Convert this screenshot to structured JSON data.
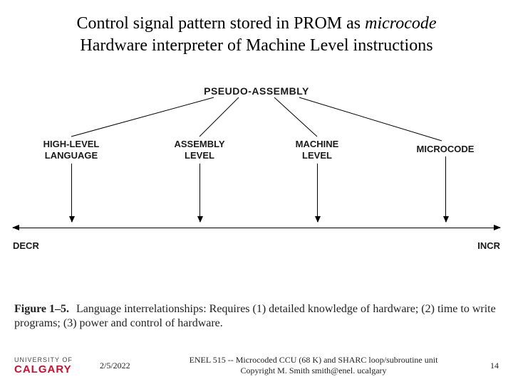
{
  "title": {
    "line1_a": "Control signal pattern stored in PROM as ",
    "line1_b_italic": "microcode",
    "line2": "Hardware interpreter of Machine Level instructions"
  },
  "diagram": {
    "top_label": "PSEUDO-ASSEMBLY",
    "labels": {
      "high_level_l1": "HIGH-LEVEL",
      "high_level_l2": "LANGUAGE",
      "assembly_l1": "ASSEMBLY",
      "assembly_l2": "LEVEL",
      "machine_l1": "MACHINE",
      "machine_l2": "LEVEL",
      "microcode": "MICROCODE"
    },
    "axis_left": "DECR",
    "axis_right": "INCR"
  },
  "caption": {
    "figno": "Figure 1–5.",
    "text": "Language interrelationships: Requires (1) detailed knowledge of hardware; (2) time to write programs; (3) power and control of hardware."
  },
  "footer": {
    "logo_top": "UNIVERSITY OF",
    "logo_bottom": "CALGARY",
    "date": "2/5/2022",
    "center_l1": "ENEL 515 -- Microcoded CCU (68 K) and SHARC loop/subroutine unit",
    "center_l2": "Copyright M. Smith smith@enel. ucalgary",
    "page": "14"
  },
  "chart_data": {
    "type": "diagram",
    "title": "Language interrelationships",
    "top_node": "PSEUDO-ASSEMBLY",
    "axis_order_left_to_right": [
      "HIGH-LEVEL LANGUAGE",
      "ASSEMBLY LEVEL",
      "MACHINE LEVEL",
      "MICROCODE"
    ],
    "axis_left_label": "DECR",
    "axis_right_label": "INCR",
    "increasing_to_right": [
      "detailed knowledge of hardware",
      "time to write programs",
      "power and control of hardware"
    ]
  }
}
